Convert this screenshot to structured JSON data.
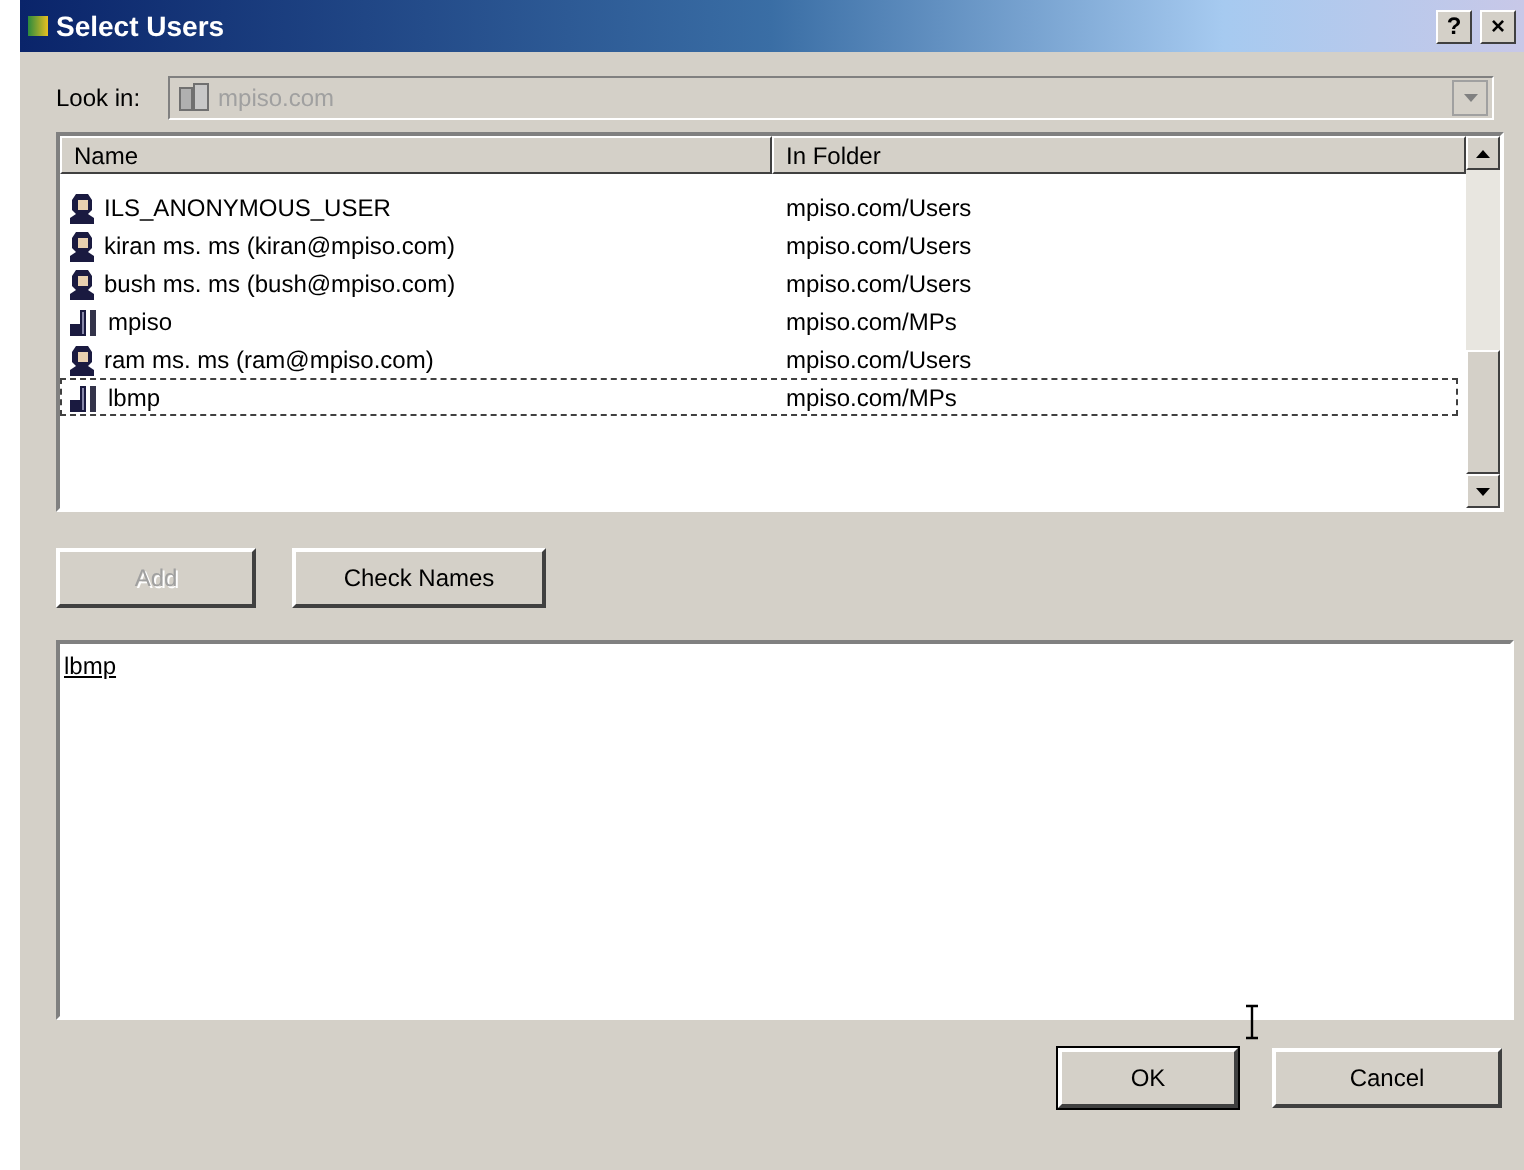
{
  "window": {
    "title": "Select Users",
    "help": "?",
    "close": "×"
  },
  "look_in": {
    "label": "Look in:",
    "value": "mpiso.com",
    "disabled": true
  },
  "table": {
    "columns": [
      "Name",
      "In Folder"
    ],
    "rows": [
      {
        "kind": "user",
        "name": "ILS_ANONYMOUS_USER",
        "folder": "mpiso.com/Users",
        "selected": false
      },
      {
        "kind": "user",
        "name": "kiran ms. ms (kiran@mpiso.com)",
        "folder": "mpiso.com/Users",
        "selected": false
      },
      {
        "kind": "user",
        "name": "bush ms. ms (bush@mpiso.com)",
        "folder": "mpiso.com/Users",
        "selected": false
      },
      {
        "kind": "group",
        "name": "mpiso",
        "folder": "mpiso.com/MPs",
        "selected": false
      },
      {
        "kind": "user",
        "name": "ram ms. ms (ram@mpiso.com)",
        "folder": "mpiso.com/Users",
        "selected": false
      },
      {
        "kind": "group",
        "name": "lbmp",
        "folder": "mpiso.com/MPs",
        "selected": true
      }
    ]
  },
  "buttons": [
    {
      "label": "Add",
      "disabled": true
    },
    {
      "label": "Check Names",
      "disabled": false
    }
  ],
  "names_box": {
    "value": "lbmp"
  },
  "footer_buttons": [
    {
      "label": "OK",
      "default": true
    },
    {
      "label": "Cancel",
      "default": false
    }
  ]
}
